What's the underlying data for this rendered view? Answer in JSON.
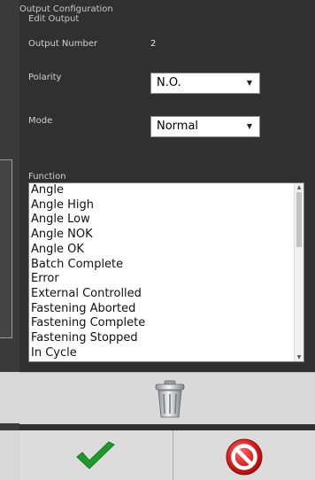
{
  "dialog": {
    "title": "Output Configuration",
    "subtitle": "Edit Output"
  },
  "output_number": {
    "label": "Output Number",
    "value": "2"
  },
  "polarity": {
    "label": "Polarity",
    "selected": "N.O."
  },
  "mode": {
    "label": "Mode",
    "selected": "Normal"
  },
  "function": {
    "label": "Function",
    "items": [
      "Angle",
      "Angle High",
      "Angle Low",
      "Angle NOK",
      "Angle OK",
      "Batch Complete",
      "Error",
      "External Controlled",
      "Fastening Aborted",
      "Fastening Complete",
      "Fastening Stopped",
      "In Cycle"
    ]
  },
  "icons": {
    "delete": "trash-icon",
    "confirm": "checkmark-icon",
    "cancel": "no-entry-icon"
  },
  "colors": {
    "confirm": "#1e9a2b",
    "cancel": "#d81c1c",
    "dialog_bg": "#303030"
  }
}
